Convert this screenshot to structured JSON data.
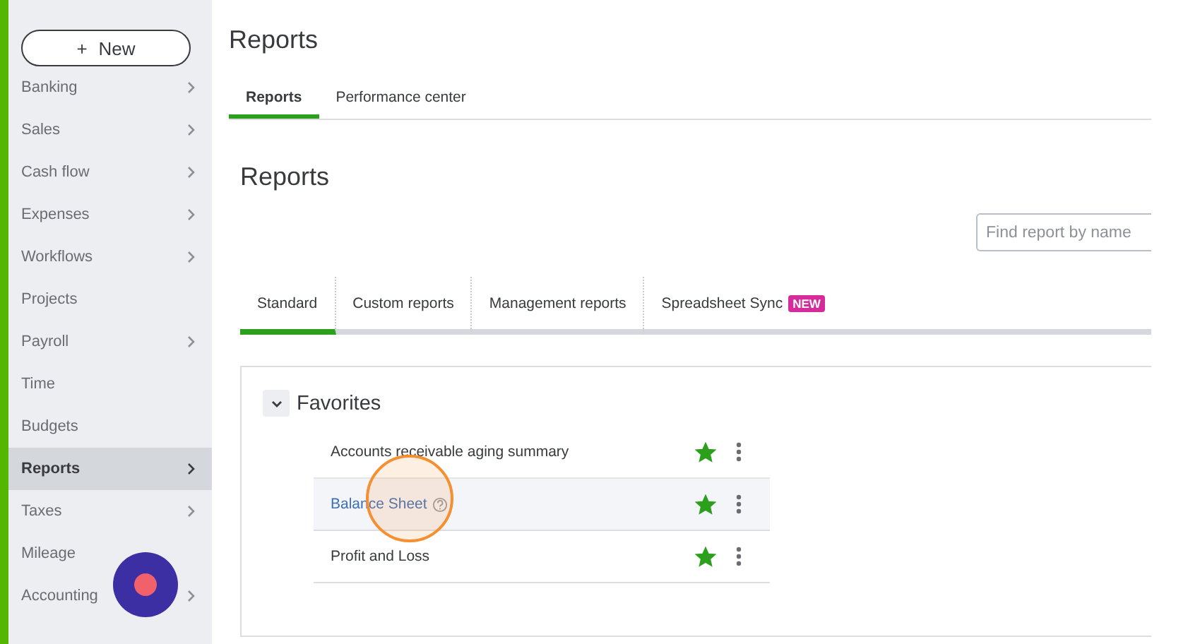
{
  "new_button": {
    "icon": "+",
    "label": "New"
  },
  "sidebar": {
    "items": [
      {
        "label": "Banking",
        "has_submenu": true,
        "selected": false
      },
      {
        "label": "Sales",
        "has_submenu": true,
        "selected": false
      },
      {
        "label": "Cash flow",
        "has_submenu": true,
        "selected": false
      },
      {
        "label": "Expenses",
        "has_submenu": true,
        "selected": false
      },
      {
        "label": "Workflows",
        "has_submenu": true,
        "selected": false
      },
      {
        "label": "Projects",
        "has_submenu": false,
        "selected": false
      },
      {
        "label": "Payroll",
        "has_submenu": true,
        "selected": false
      },
      {
        "label": "Time",
        "has_submenu": false,
        "selected": false
      },
      {
        "label": "Budgets",
        "has_submenu": false,
        "selected": false
      },
      {
        "label": "Reports",
        "has_submenu": true,
        "selected": true
      },
      {
        "label": "Taxes",
        "has_submenu": true,
        "selected": false
      },
      {
        "label": "Mileage",
        "has_submenu": false,
        "selected": false
      },
      {
        "label": "Accounting",
        "has_submenu": true,
        "selected": false
      }
    ]
  },
  "page": {
    "title": "Reports",
    "tabs": [
      {
        "label": "Reports",
        "selected": true
      },
      {
        "label": "Performance center",
        "selected": false
      }
    ],
    "heading": "Reports",
    "search": {
      "placeholder": "Find report by name"
    },
    "report_tabs": [
      {
        "label": "Standard",
        "selected": true
      },
      {
        "label": "Custom reports",
        "selected": false
      },
      {
        "label": "Management reports",
        "selected": false
      },
      {
        "label": "Spreadsheet Sync",
        "selected": false,
        "badge": "NEW"
      }
    ],
    "favorites": {
      "title": "Favorites",
      "expanded": true,
      "reports": [
        {
          "name": "Accounts receivable aging summary",
          "favorite": true,
          "hovered": false,
          "help": false
        },
        {
          "name": "Balance Sheet",
          "favorite": true,
          "hovered": true,
          "help": true
        },
        {
          "name": "Profit and Loss",
          "favorite": true,
          "hovered": false,
          "help": false
        }
      ]
    }
  }
}
